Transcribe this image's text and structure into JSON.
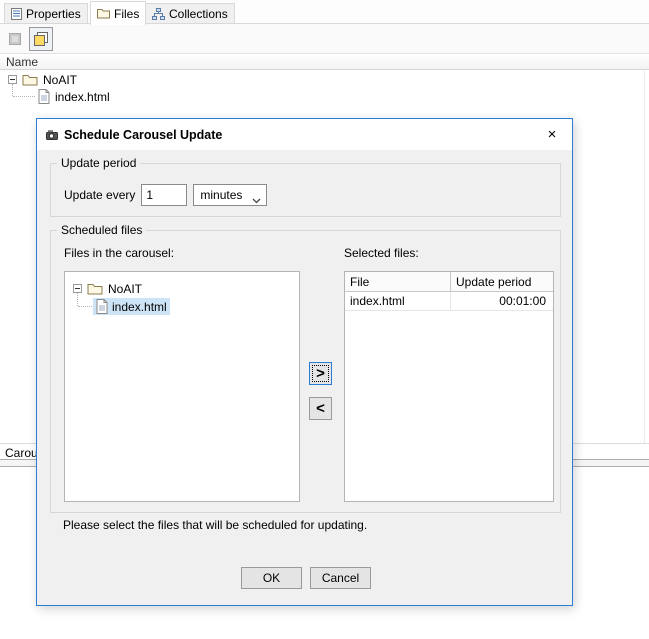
{
  "colors": {
    "accent": "#2b7cd3",
    "selection": "#cde4f7",
    "dialog_bg": "#f0f0f0"
  },
  "tabs": {
    "items": [
      {
        "label": "Properties"
      },
      {
        "label": "Files"
      },
      {
        "label": "Collections"
      }
    ]
  },
  "files_panel": {
    "column_header": "Name",
    "tree": {
      "root_label": "NoAIT",
      "child_label": "index.html"
    }
  },
  "bottom_bar": {
    "partial_tab_label": "Carou"
  },
  "dialog": {
    "title": "Schedule Carousel Update",
    "close_glyph": "×",
    "update_period": {
      "legend": "Update period",
      "label": "Update every",
      "value": "1",
      "unit": "minutes"
    },
    "scheduled_files": {
      "legend": "Scheduled files",
      "carousel_label": "Files in the carousel:",
      "selected_label": "Selected files:",
      "tree": {
        "root_label": "NoAIT",
        "child_label": "index.html"
      },
      "add_glyph": ">",
      "remove_glyph": "<",
      "table": {
        "columns": [
          "File",
          "Update period"
        ],
        "rows": [
          {
            "file": "index.html",
            "period": "00:01:00"
          }
        ]
      }
    },
    "hint": "Please select the files that will be scheduled for updating.",
    "buttons": {
      "ok": "OK",
      "cancel": "Cancel"
    }
  }
}
